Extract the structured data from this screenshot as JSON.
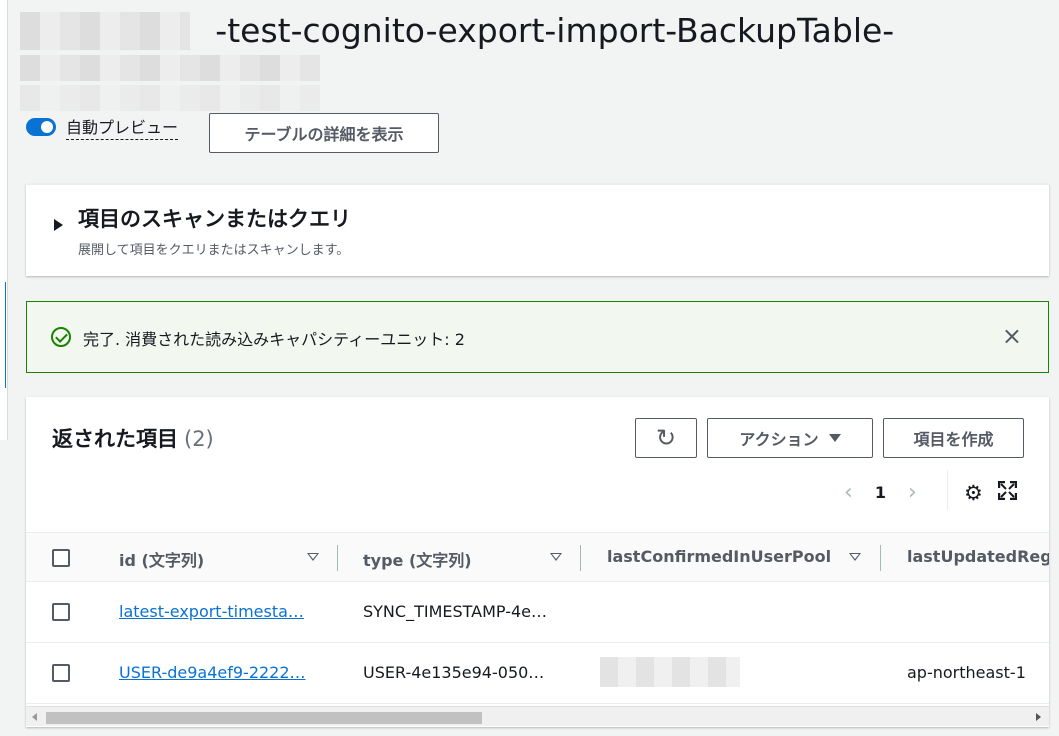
{
  "page": {
    "title": "-test-cognito-export-import-BackupTable-"
  },
  "toolbar": {
    "auto_preview_label": "自動プレビュー",
    "auto_preview_on": true,
    "details_button": "テーブルの詳細を表示"
  },
  "scan_panel": {
    "title": "項目のスキャンまたはクエリ",
    "description": "展開して項目をクエリまたはスキャンします。"
  },
  "banner": {
    "message": "完了. 消費された読み込みキャパシティーユニット: 2",
    "status_color": "#1d8102",
    "close_icon": "×"
  },
  "items": {
    "title": "返された項目",
    "count": "(2)",
    "refresh_icon": "↻",
    "action_button": "アクション",
    "create_button": "項目を作成",
    "prev_icon": "‹",
    "page": "1",
    "next_icon": "›",
    "settings_icon": "⚙"
  },
  "table": {
    "columns": [
      "id (文字列)",
      "type (文字列)",
      "lastConfirmedInUserPool",
      "lastUpdatedRegio"
    ],
    "rows": [
      {
        "id": "latest-export-timesta…",
        "type": "SYNC_TIMESTAMP-4e…",
        "lastConfirmedInUserPool": "",
        "lastUpdatedRegion": ""
      },
      {
        "id": "USER-de9a4ef9-2222…",
        "type": "USER-4e135e94-050…",
        "lastConfirmedInUserPool": "",
        "lastUpdatedRegion": "ap-northeast-1"
      }
    ]
  },
  "colors": {
    "accent": "#0972d3",
    "success": "#1d8102"
  }
}
